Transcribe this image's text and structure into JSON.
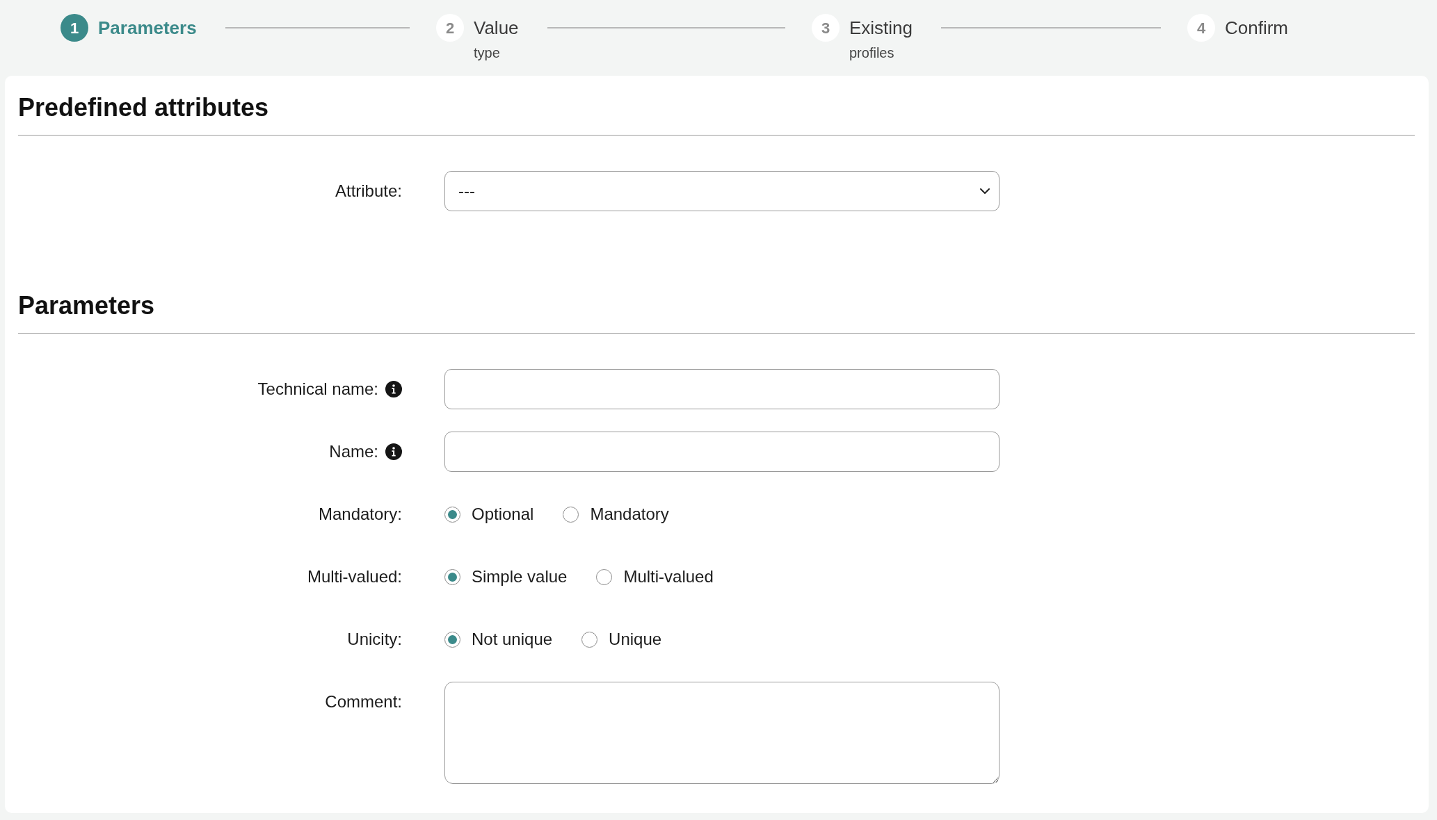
{
  "stepper": {
    "steps": [
      {
        "number": "1",
        "label": "Parameters",
        "selected": true
      },
      {
        "number": "2",
        "label": "Value",
        "sublabel": "type",
        "selected": false
      },
      {
        "number": "3",
        "label": "Existing",
        "sublabel": "profiles",
        "selected": false
      },
      {
        "number": "4",
        "label": "Confirm",
        "selected": false
      }
    ]
  },
  "sections": [
    {
      "title": "Predefined attributes",
      "fields": [
        {
          "kind": "select",
          "label": "Attribute:",
          "value": "---"
        }
      ]
    },
    {
      "title": "Parameters",
      "fields": [
        {
          "kind": "text",
          "label": "Technical name:",
          "info": true
        },
        {
          "kind": "text",
          "label": "Name:",
          "info": true
        },
        {
          "kind": "radio",
          "label": "Mandatory:",
          "options": [
            {
              "label": "Optional",
              "selected": true
            },
            {
              "label": "Mandatory",
              "selected": false
            }
          ]
        },
        {
          "kind": "radio",
          "label": "Multi-valued:",
          "options": [
            {
              "label": "Simple value",
              "selected": true
            },
            {
              "label": "Multi-valued",
              "selected": false
            }
          ]
        },
        {
          "kind": "radio",
          "label": "Unicity:",
          "options": [
            {
              "label": "Not unique",
              "selected": true
            },
            {
              "label": "Unique",
              "selected": false
            }
          ]
        },
        {
          "kind": "textarea",
          "label": "Comment:"
        }
      ]
    }
  ]
}
